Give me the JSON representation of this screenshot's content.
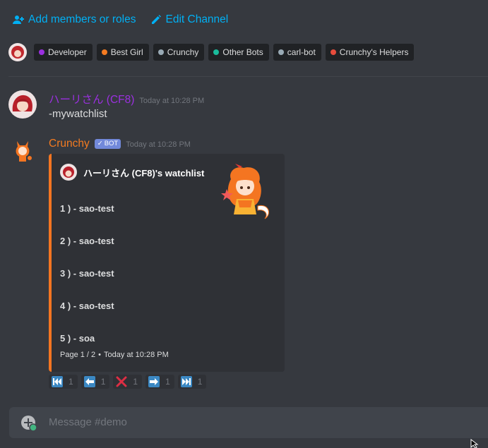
{
  "actions": {
    "add_members": "Add members or roles",
    "edit_channel": "Edit Channel"
  },
  "roles": [
    {
      "label": "Developer",
      "color": "#9b30e0"
    },
    {
      "label": "Best Girl",
      "color": "#f47b21"
    },
    {
      "label": "Crunchy",
      "color": "#99aab5"
    },
    {
      "label": "Other Bots",
      "color": "#1abc9c"
    },
    {
      "label": "carl-bot",
      "color": "#99aab5"
    },
    {
      "label": "Crunchy's Helpers",
      "color": "#e74c3c"
    }
  ],
  "messages": [
    {
      "username": "ハーリさん (CF8)",
      "username_color": "#9b30e0",
      "timestamp": "Today at 10:28 PM",
      "text": "-mywatchlist"
    },
    {
      "username": "Crunchy",
      "username_color": "#f47b21",
      "bot_tag": "BOT",
      "timestamp": "Today at 10:28 PM"
    }
  ],
  "embed": {
    "accent": "#f47521",
    "author": "ハーリさん (CF8)'s watchlist",
    "fields": [
      "1 ) - sao-test",
      "2 ) - sao-test",
      "3 ) - sao-test",
      "4 ) - sao-test",
      "5 ) - soa"
    ],
    "footer_page": "Page 1 / 2",
    "footer_sep": "•",
    "footer_time": "Today at 10:28 PM"
  },
  "reactions": [
    {
      "icon": "track-previous-icon",
      "count": "1"
    },
    {
      "icon": "arrow-left-icon",
      "count": "1"
    },
    {
      "icon": "cross-mark-icon",
      "count": "1"
    },
    {
      "icon": "arrow-right-icon",
      "count": "1"
    },
    {
      "icon": "track-next-icon",
      "count": "1"
    }
  ],
  "composer": {
    "placeholder": "Message #demo"
  }
}
